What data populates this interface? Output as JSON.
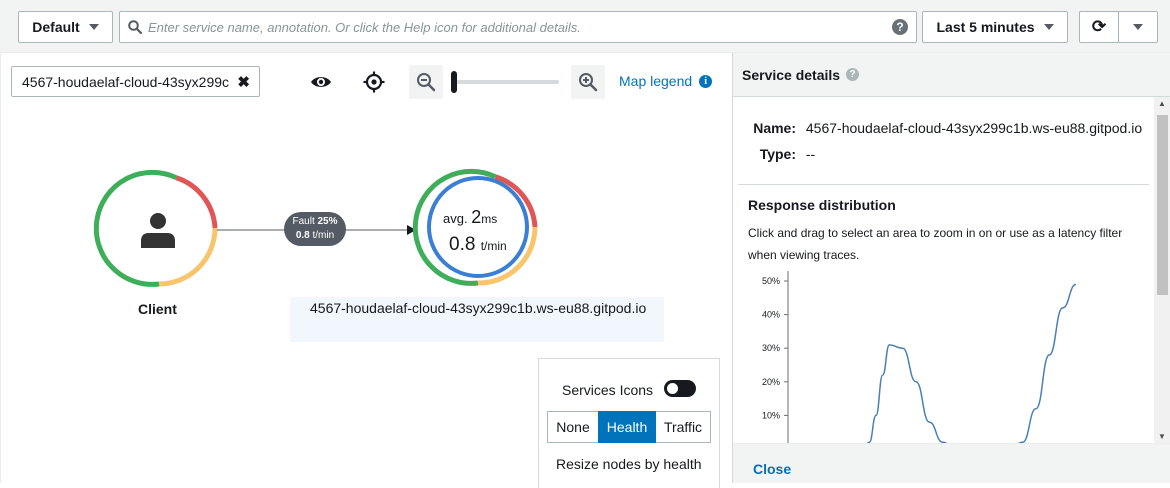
{
  "toolbar": {
    "group_label": "Default",
    "search_placeholder": "Enter service name, annotation. Or click the Help icon for additional details.",
    "help_glyph": "?",
    "time_range_label": "Last 5 minutes",
    "refresh_glyph": "⟳"
  },
  "map": {
    "filter_value": "4567-houdaelaf-cloud-43syx299c",
    "filter_clear_glyph": "✖",
    "legend_label": "Map legend",
    "legend_info_glyph": "i",
    "zoom_level": 0,
    "client_node": {
      "label": "Client"
    },
    "edge": {
      "fault_label": "Fault",
      "fault_pct": "25%",
      "rate_value": "0.8",
      "rate_unit": "t/min"
    },
    "service_node": {
      "avg_prefix": "avg.",
      "avg_value": "2",
      "avg_unit": "ms",
      "rate_value": "0.8",
      "rate_unit": "t/min",
      "label": "4567-houdaelaf-cloud-43syx299c1b.ws-eu88.gitpod.io"
    },
    "colors": {
      "ok": "#3fae5a",
      "fault": "#e05556",
      "error": "#f8c56c",
      "selected": "#3b7fd4",
      "edge": "#545b64"
    }
  },
  "settings": {
    "services_icons_label": "Services Icons",
    "services_icons_on": false,
    "resize_options": [
      "None",
      "Health",
      "Traffic"
    ],
    "resize_selected": "Health",
    "resize_label": "Resize nodes by health"
  },
  "panel": {
    "title": "Service details",
    "help_glyph": "?",
    "name_key": "Name:",
    "name_value": "4567-houdaelaf-cloud-43syx299c1b.ws-eu88.gitpod.io",
    "type_key": "Type:",
    "type_value": "--",
    "distribution_title": "Response distribution",
    "distribution_desc": "Click and drag to select an area to zoom in on or use as a latency filter when viewing traces.",
    "close_label": "Close"
  },
  "chart_data": {
    "type": "line",
    "title": "Response distribution",
    "y_ticks": [
      "50%",
      "40%",
      "30%",
      "20%",
      "10%"
    ],
    "ylim": [
      0,
      50
    ],
    "x": [
      0,
      10,
      20,
      30,
      40,
      50,
      55,
      60,
      65,
      70,
      80,
      90,
      100,
      110,
      120,
      130,
      140,
      150,
      160,
      170,
      180,
      190,
      200,
      210
    ],
    "values": [
      0,
      0,
      0,
      0,
      0,
      0,
      2,
      10,
      22,
      31,
      30,
      20,
      8,
      2,
      0,
      0,
      0,
      0,
      0,
      2,
      12,
      28,
      42,
      49
    ],
    "grid": false,
    "series_color": "#4a7fb5"
  }
}
